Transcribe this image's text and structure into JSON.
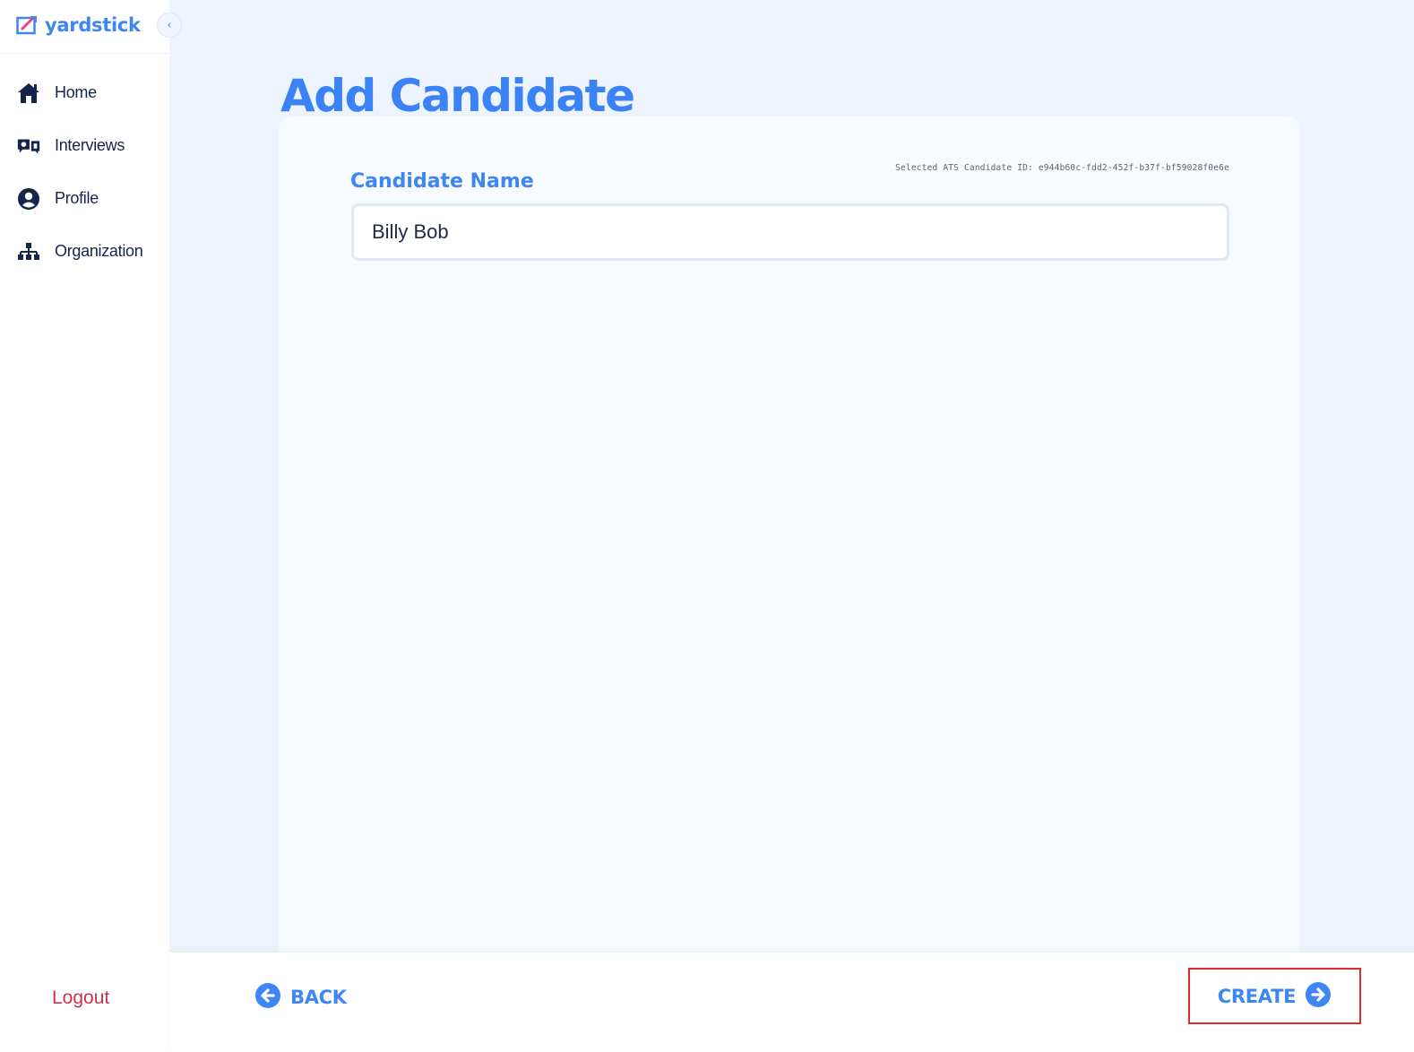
{
  "brand": {
    "name": "yardstick",
    "logo_icon": "yardstick-logo-icon",
    "collapse_icon": "chevron-left-icon",
    "collapse_glyph": "‹"
  },
  "sidebar": {
    "items": [
      {
        "label": "Home",
        "icon": "home-icon"
      },
      {
        "label": "Interviews",
        "icon": "interviews-icon"
      },
      {
        "label": "Profile",
        "icon": "user-circle-icon"
      },
      {
        "label": "Organization",
        "icon": "org-chart-icon"
      }
    ],
    "logout_label": "Logout"
  },
  "main": {
    "title": "Add Candidate",
    "ats_candidate_id": "Selected ATS Candidate ID: e944b60c-fdd2-452f-b37f-bf59028f0e6e",
    "field_label": "Candidate Name",
    "name_value": "Billy Bob"
  },
  "footer": {
    "back_label": "BACK",
    "back_icon": "arrow-left-circle-icon",
    "create_label": "CREATE",
    "create_icon": "arrow-right-circle-icon"
  },
  "colors": {
    "accent": "#3e86f4",
    "nav_text": "#14254a",
    "logout": "#c9344e",
    "main_bg": "#eef4fd",
    "card_bg": "#f7faff",
    "highlight_border": "#e02a2a"
  }
}
